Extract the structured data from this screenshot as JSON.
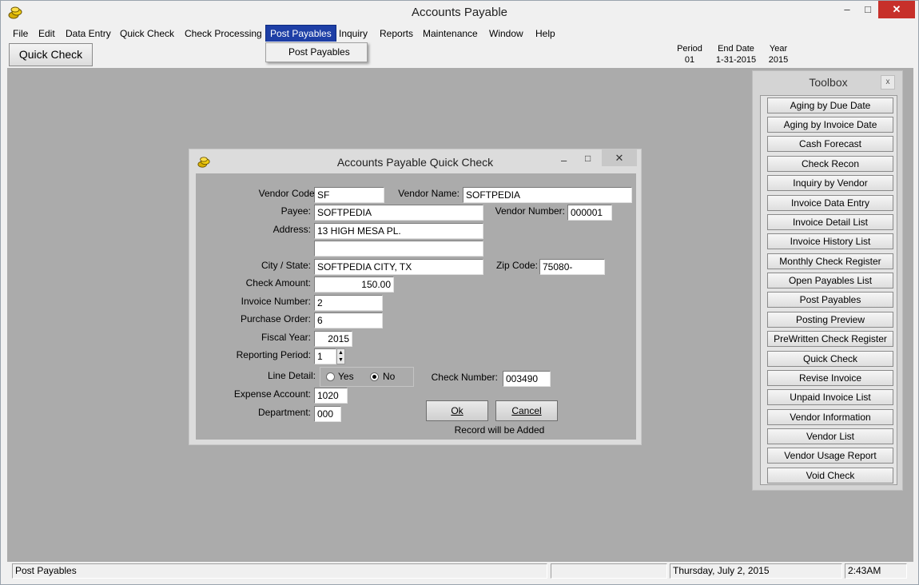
{
  "window": {
    "title": "Accounts Payable",
    "controls": {
      "minimize": "–",
      "maximize": "□",
      "close": "✕"
    },
    "icon": "coins-icon"
  },
  "menu": {
    "items": [
      "File",
      "Edit",
      "Data Entry",
      "Quick Check",
      "Check Processing",
      "Post Payables",
      "Inquiry",
      "Reports",
      "Maintenance",
      "Window",
      "Help"
    ],
    "active": "Post Payables",
    "dropdown_item": "Post Payables"
  },
  "toolbar": {
    "quick_check_label": "Quick Check",
    "period_label": "Period",
    "period_value": "01",
    "end_date_label": "End Date",
    "end_date_value": "1-31-2015",
    "year_label": "Year",
    "year_value": "2015"
  },
  "toolbox": {
    "title": "Toolbox",
    "close": "x",
    "items": [
      "Aging by Due Date",
      "Aging by Invoice Date",
      "Cash Forecast",
      "Check Recon",
      "Inquiry by Vendor",
      "Invoice Data Entry",
      "Invoice Detail List",
      "Invoice History List",
      "Monthly Check Register",
      "Open Payables List",
      "Post Payables",
      "Posting Preview",
      "PreWritten Check Register",
      "Quick Check",
      "Revise Invoice",
      "Unpaid Invoice List",
      "Vendor Information",
      "Vendor List",
      "Vendor Usage Report",
      "Void Check"
    ]
  },
  "dialog": {
    "title": "Accounts Payable Quick Check",
    "controls": {
      "minimize": "–",
      "maximize": "□",
      "close": "✕"
    },
    "labels": {
      "vendor_code": "Vendor Code:",
      "vendor_name": "Vendor Name:",
      "payee": "Payee:",
      "vendor_number": "Vendor Number:",
      "address": "Address:",
      "city_state": "City / State:",
      "zip_code": "Zip Code:",
      "check_amount": "Check Amount:",
      "invoice_number": "Invoice Number:",
      "purchase_order": "Purchase Order:",
      "fiscal_year": "Fiscal Year:",
      "reporting_period": "Reporting Period:",
      "line_detail": "Line Detail:",
      "check_number": "Check Number:",
      "expense_account": "Expense Account:",
      "department": "Department:"
    },
    "values": {
      "vendor_code": "SF",
      "vendor_name": "SOFTPEDIA",
      "payee": "SOFTPEDIA",
      "vendor_number": "000001",
      "address1": "13 HIGH MESA PL.",
      "address2": "",
      "city_state": "SOFTPEDIA CITY, TX",
      "zip_code": "75080-",
      "check_amount": "150.00",
      "invoice_number": "2",
      "purchase_order": "6",
      "fiscal_year": "2015",
      "reporting_period": "1",
      "check_number": "003490",
      "expense_account": "1020",
      "department": "000"
    },
    "line_detail": {
      "yes_label": "Yes",
      "no_label": "No",
      "selected": "No"
    },
    "ok_label": "Ok",
    "cancel_label": "Cancel",
    "record_message": "Record will be Added"
  },
  "statusbar": {
    "message": "Post Payables",
    "date": "Thursday, July  2, 2015",
    "time": "2:43AM"
  }
}
